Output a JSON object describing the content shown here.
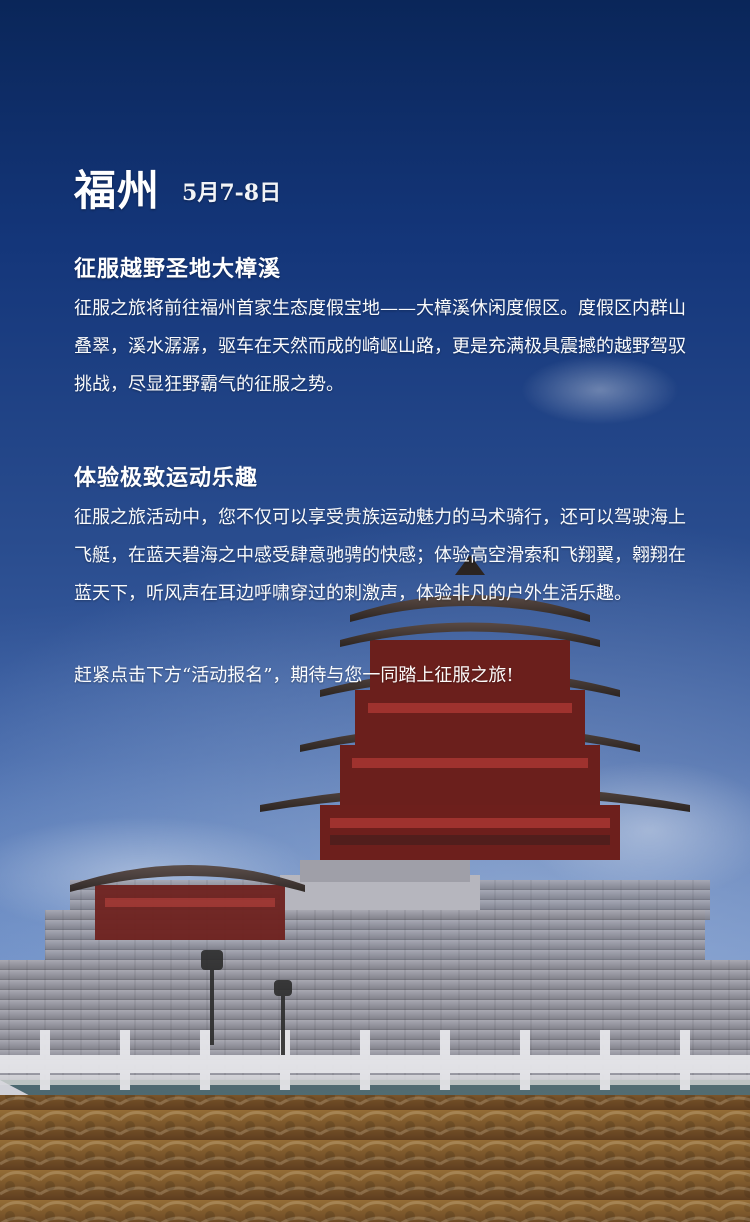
{
  "header": {
    "city": "福州",
    "date": "5月7-8日"
  },
  "sections": [
    {
      "title": "征服越野圣地大樟溪",
      "body": "征服之旅将前往福州首家生态度假宝地——大樟溪休闲度假区。度假区内群山叠翠，溪水潺潺，驱车在天然而成的崎岖山路，更是充满极具震撼的越野驾驭挑战，尽显狂野霸气的征服之势。"
    },
    {
      "title": "体验极致运动乐趣",
      "body": "征服之旅活动中，您不仅可以享受贵族运动魅力的马术骑行，还可以驾驶海上飞艇，在蓝天碧海之中感受肆意驰骋的快感；体验高空滑索和飞翔翼，翱翔在蓝天下，听风声在耳边呼啸穿过的刺激声，体验非凡的户外生活乐趣。"
    }
  ],
  "cta": "赶紧点击下方“活动报名”，期待与您一同踏上征服之旅!"
}
